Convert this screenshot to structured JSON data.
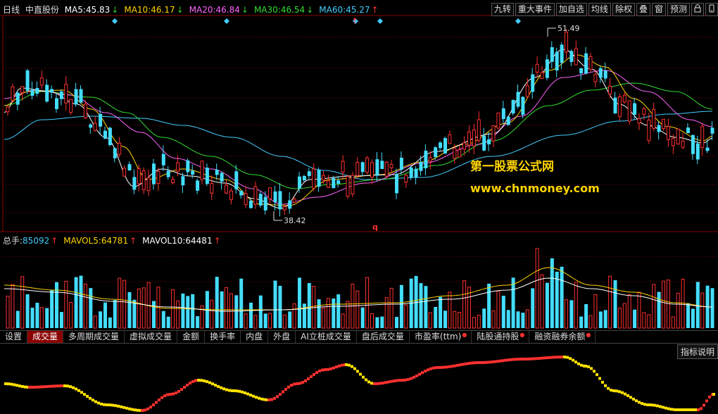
{
  "header": {
    "period": "日线",
    "stock_name": "中直股份",
    "ma": [
      {
        "label": "MA5:",
        "value": "45.83",
        "arrow": "↓",
        "color": "#ffffff",
        "arrow_color": "#33cc33"
      },
      {
        "label": "MA10:",
        "value": "46.17",
        "arrow": "↓",
        "color": "#ffd400",
        "arrow_color": "#33cc33"
      },
      {
        "label": "MA20:",
        "value": "46.84",
        "arrow": "↓",
        "color": "#ff66ff",
        "arrow_color": "#33cc33"
      },
      {
        "label": "MA30:",
        "value": "46.54",
        "arrow": "↓",
        "color": "#33dd33",
        "arrow_color": "#33cc33"
      },
      {
        "label": "MA60:",
        "value": "45.27",
        "arrow": "↑",
        "color": "#44ccff",
        "arrow_color": "#ff3030"
      }
    ]
  },
  "toolbar": {
    "buttons": [
      "九转",
      "重大事件",
      "加自选",
      "均线",
      "除权",
      "叠",
      "窗",
      "预测"
    ],
    "lock_icon": "lock-icon",
    "mobile_icon": "mobile-icon"
  },
  "price_chart": {
    "high_label": "51.49",
    "low_label": "38.42",
    "marker_q": "q"
  },
  "volume": {
    "legend": [
      {
        "label": "总手:",
        "value": "85092",
        "arrow": "↑",
        "color": "#44ccff"
      },
      {
        "label": "MAVOL5:",
        "value": "64781",
        "arrow": "↑",
        "color": "#ffd400"
      },
      {
        "label": "MAVOL10:",
        "value": "64481",
        "arrow": "↑",
        "color": "#ffffff"
      }
    ]
  },
  "tabs": [
    {
      "label": "设置",
      "active": false,
      "dot": false
    },
    {
      "label": "成交量",
      "active": true,
      "dot": false
    },
    {
      "label": "多周期成交量",
      "active": false,
      "dot": false
    },
    {
      "label": "虚拟成交量",
      "active": false,
      "dot": false
    },
    {
      "label": "金额",
      "active": false,
      "dot": false
    },
    {
      "label": "换手率",
      "active": false,
      "dot": false
    },
    {
      "label": "内盘",
      "active": false,
      "dot": false
    },
    {
      "label": "外盘",
      "active": false,
      "dot": false
    },
    {
      "label": "AI立桩成交量",
      "active": false,
      "dot": false
    },
    {
      "label": "盘后成交量",
      "active": false,
      "dot": false
    },
    {
      "label": "市盈率(ttm)",
      "active": false,
      "dot": true
    },
    {
      "label": "陆股通持股",
      "active": false,
      "dot": true
    },
    {
      "label": "融资融券余额",
      "active": false,
      "dot": true
    }
  ],
  "indicator_button": "指标说明",
  "watermark": {
    "line1": "第一股票公式网",
    "line2": "www.chnmoney.com"
  },
  "colors": {
    "up": "#ff3030",
    "down": "#44ddff",
    "ma5": "#ffffff",
    "ma10": "#ffd400",
    "ma20": "#ff66ff",
    "ma30": "#33dd33",
    "ma60": "#44ccff",
    "grid": "#8b0000"
  }
}
